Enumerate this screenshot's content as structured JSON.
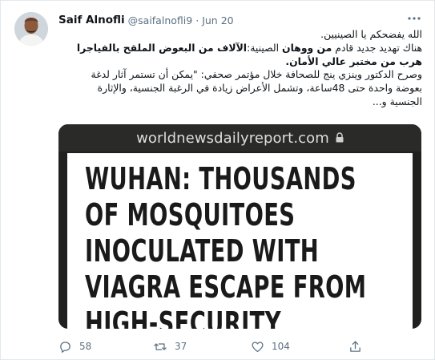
{
  "tweet": {
    "author_name": "Saif Alnofli",
    "author_handle": "@saifalnofli9",
    "separator": "·",
    "date": "Jun 20",
    "more_icon": "more-icon",
    "text": {
      "line1": "الله يفضحكم يا الصينيين.",
      "line2_plain": "هناك تهديد جديد قادم ",
      "line2_bold1": "من ووهان",
      "line2_plain2": " الصينية:",
      "line2_bold2": "الآلاف من البعوض الملقح بالفياجرا",
      "line3_bold": "هرب من مختبر عالي الأمان.",
      "line4": "وصرح الدكتور وينزي ينج للصحافة خلال مؤتمر صحفي: \"يمكن أن تستمر آثار لدغة",
      "line5": "بعوضة واحدة حتى 48ساعة، وتشمل الأعراض زيادة في الرغبة الجنسية، والإثارة",
      "line6": "الجنسية و..."
    }
  },
  "media": {
    "url": "worldnewsdailyreport.com",
    "lock_icon": "lock-icon",
    "headline_lines": [
      "WUHAN: THOUSANDS",
      "OF MOSQUITOES",
      "INOCULATED WITH",
      "VIAGRA ESCAPE FROM",
      "HIGH-SECURITY"
    ]
  },
  "actions": {
    "reply_count": "58",
    "retweet_count": "37",
    "like_count": "104"
  },
  "colors": {
    "text": "#0f1419",
    "secondary": "#5b7083",
    "border": "#e1e8ed",
    "media_bar": "#2a2a29"
  }
}
